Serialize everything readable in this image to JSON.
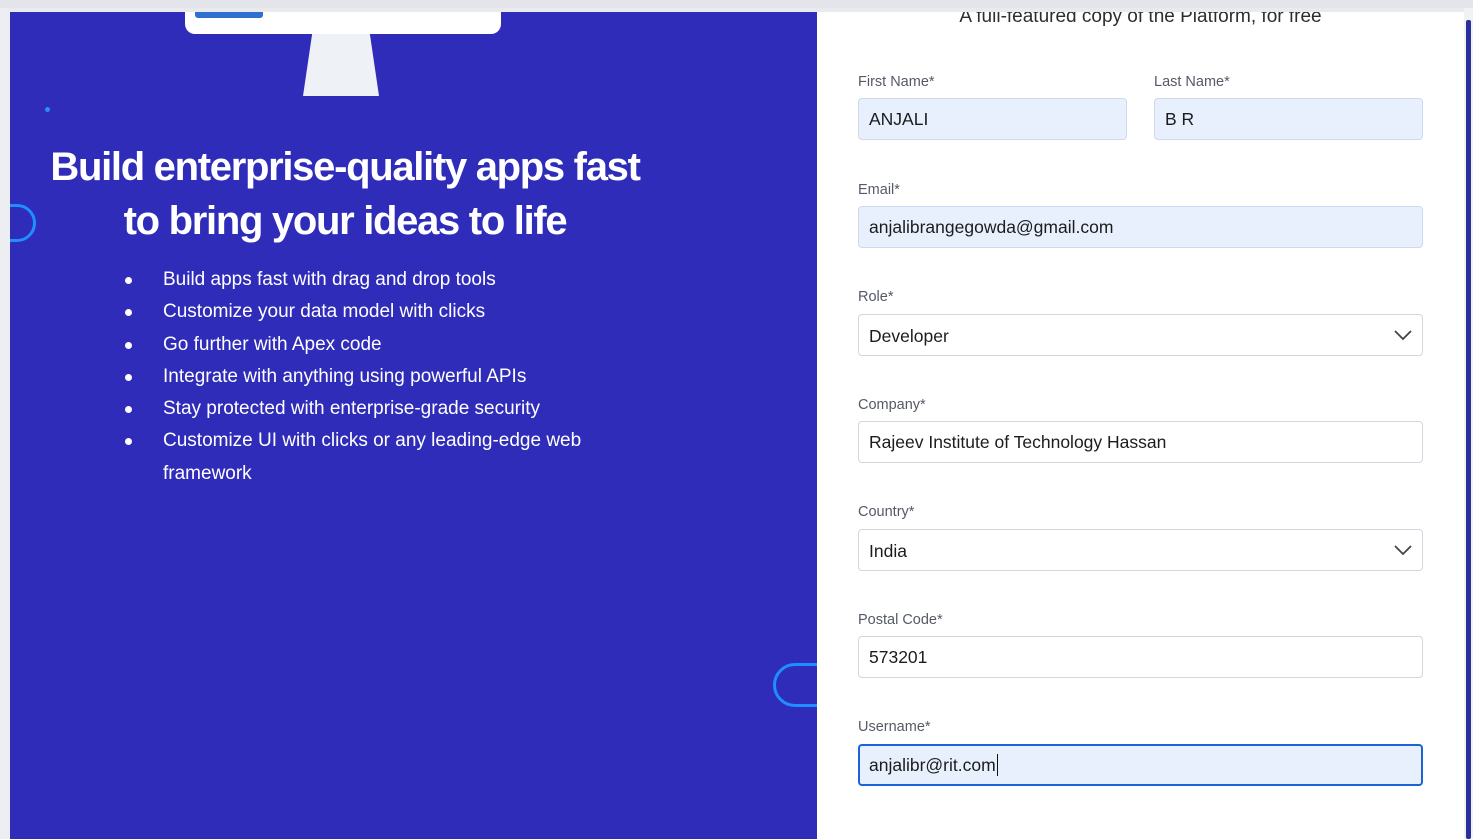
{
  "hero": {
    "headline": "Build enterprise-quality apps fast to bring your ideas to life",
    "features": [
      "Build apps fast with drag and drop tools",
      "Customize your data model with clicks",
      "Go further with Apex code",
      "Integrate with anything using powerful APIs",
      "Stay protected with enterprise-grade security",
      "Customize UI with clicks or any leading-edge web framework"
    ]
  },
  "form": {
    "tagline": "A full-featured copy of the Platform, for free",
    "first_name": {
      "label": "First Name*",
      "value": "ANJALI"
    },
    "last_name": {
      "label": "Last Name*",
      "value": "B R"
    },
    "email": {
      "label": "Email*",
      "value": "anjalibrangegowda@gmail.com"
    },
    "role": {
      "label": "Role*",
      "value": "Developer"
    },
    "company": {
      "label": "Company*",
      "value": "Rajeev Institute of Technology Hassan"
    },
    "country": {
      "label": "Country*",
      "value": "India"
    },
    "postal_code": {
      "label": "Postal Code*",
      "value": "573201"
    },
    "username": {
      "label": "Username*",
      "value": "anjalibr@rit.com"
    }
  },
  "colors": {
    "hero_bg": "#2e2cb8",
    "accent_ring": "#1f8fff",
    "focus_border": "#1b63d6",
    "autofill_bg": "#e8f0fe"
  },
  "icons": {
    "select_chevron": "chevron-down-icon"
  }
}
